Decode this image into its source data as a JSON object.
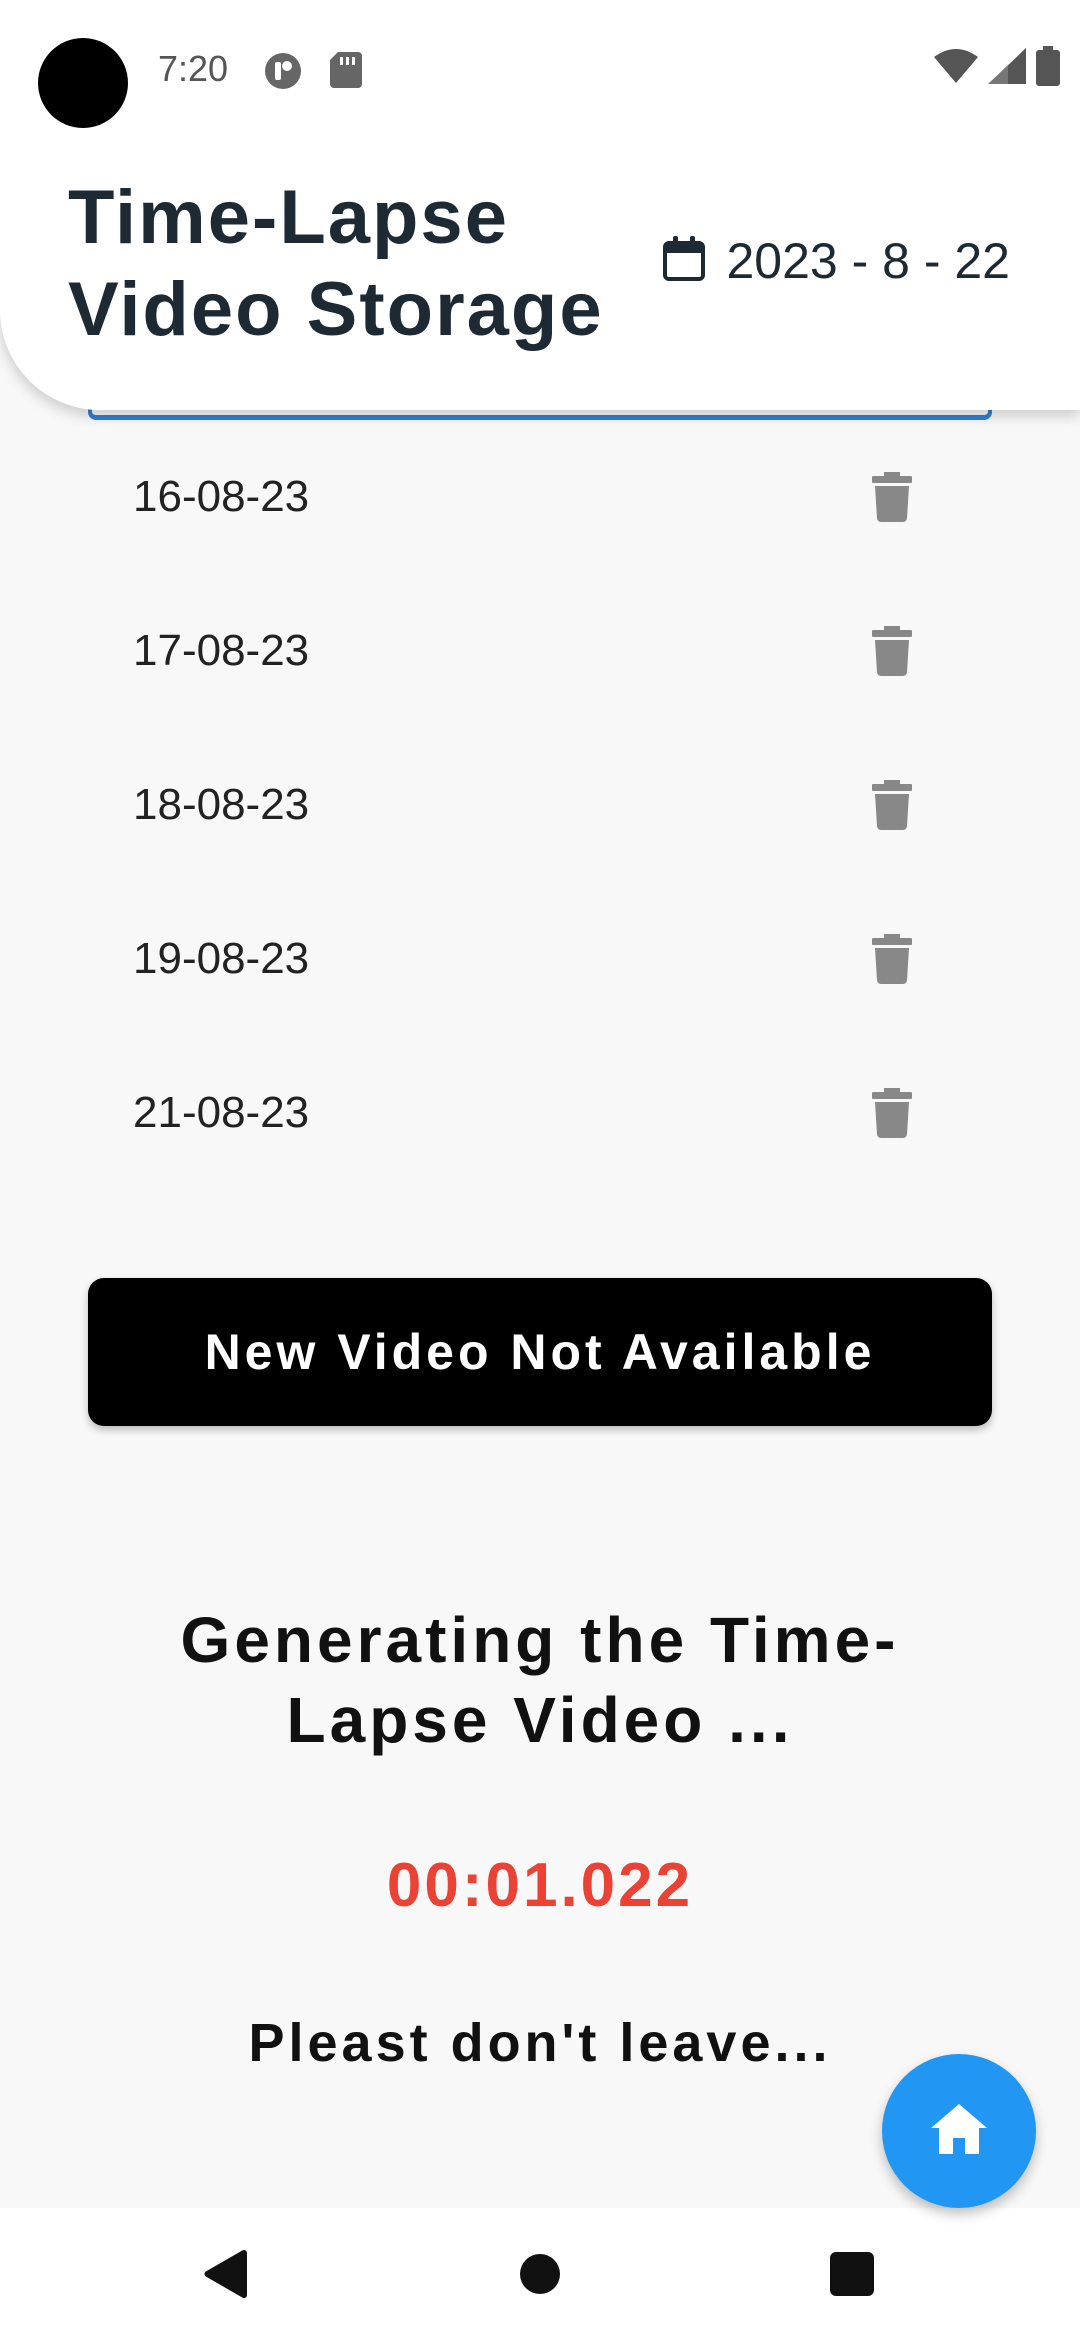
{
  "status_bar": {
    "time": "7:20",
    "icons_left": [
      "media-notification-icon",
      "sd-card-icon"
    ],
    "icons_right": [
      "wifi-icon",
      "cell-signal-icon",
      "battery-icon"
    ]
  },
  "header": {
    "title": "Time-Lapse Video Storage",
    "date": "2023 - 8 - 22",
    "date_icon": "calendar-icon"
  },
  "video_list": {
    "items": [
      {
        "date": "16-08-23"
      },
      {
        "date": "17-08-23"
      },
      {
        "date": "18-08-23"
      },
      {
        "date": "19-08-23"
      },
      {
        "date": "21-08-23"
      }
    ],
    "delete_icon": "trash-icon"
  },
  "new_video_button": {
    "label": "New Video Not Available"
  },
  "generation": {
    "title": "Generating the Time-Lapse Video ...",
    "timer": "00:01.022",
    "note": "Pleast don't leave..."
  },
  "fab": {
    "icon": "home-icon"
  },
  "nav_bar": {
    "buttons": [
      "back-icon",
      "home-circle-icon",
      "recents-icon"
    ]
  },
  "colors": {
    "accent": "#2196f3",
    "timer": "#ea4335",
    "header_text": "#1e2a33",
    "highlight_border": "#2f7fd4"
  }
}
